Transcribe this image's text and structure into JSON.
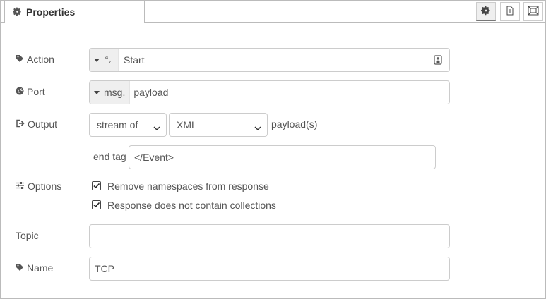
{
  "tabs": {
    "properties_label": "Properties"
  },
  "toolbar": {
    "settings_icon": "gear-icon",
    "description_icon": "document-icon",
    "appearance_icon": "frame-icon"
  },
  "fields": {
    "action": {
      "label": "Action",
      "type_prefix": "az",
      "value": "Start"
    },
    "port": {
      "label": "Port",
      "type_prefix": "msg.",
      "value": "payload"
    },
    "output": {
      "label": "Output",
      "mode": "stream of",
      "format": "XML",
      "suffix": "payload(s)"
    },
    "end_tag": {
      "label": "end tag",
      "value": "</Event>"
    },
    "options": {
      "label": "Options",
      "remove_namespaces": {
        "label": "Remove namespaces from response",
        "checked": true
      },
      "no_collections": {
        "label": "Response does not contain collections",
        "checked": true
      }
    },
    "topic": {
      "label": "Topic",
      "value": ""
    },
    "name": {
      "label": "Name",
      "value": "TCP"
    }
  }
}
